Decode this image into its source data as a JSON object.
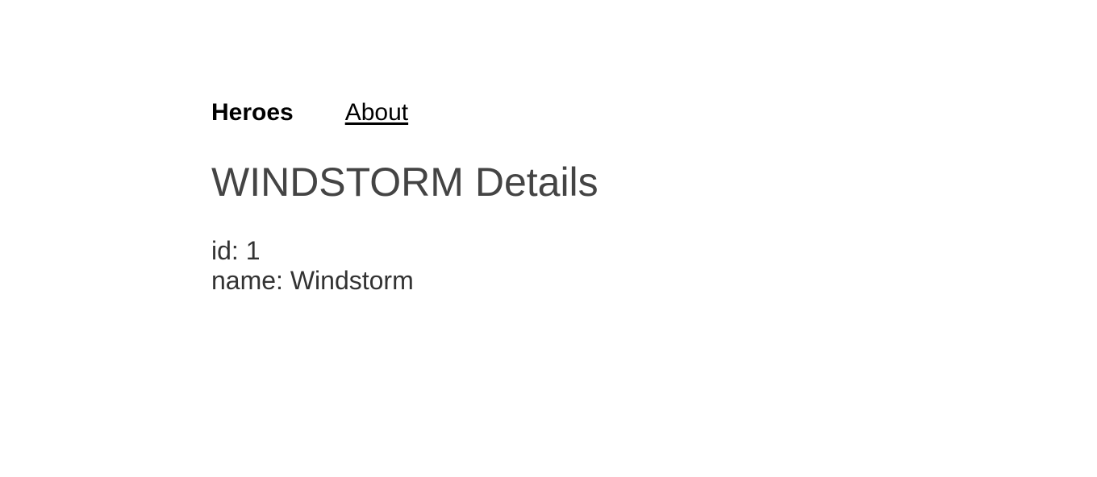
{
  "nav": {
    "items": [
      {
        "label": "Heroes",
        "active": true
      },
      {
        "label": "About",
        "active": false
      }
    ]
  },
  "hero_detail": {
    "title": "WINDSTORM Details",
    "id_label": "id: ",
    "id_value": "1",
    "name_label": "name: ",
    "name_value": "Windstorm"
  },
  "colors": {
    "title": "#444444",
    "body_text": "#333333",
    "nav_text": "#000000",
    "background": "#ffffff"
  }
}
